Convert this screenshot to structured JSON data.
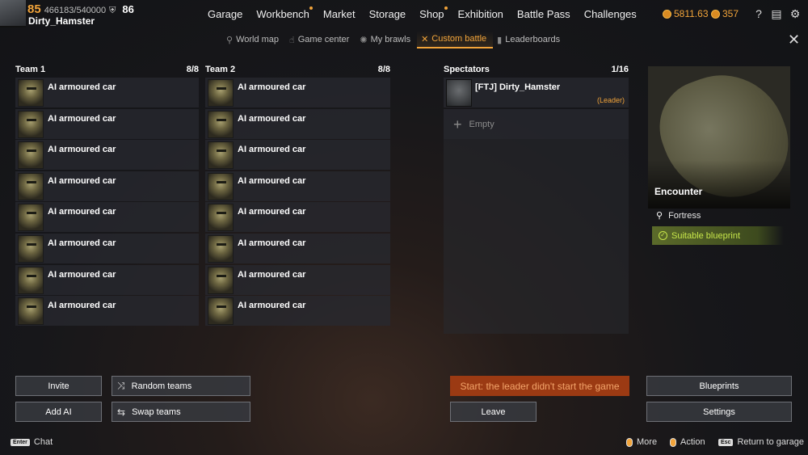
{
  "player": {
    "level": "85",
    "experience": "466183/540000",
    "power_score": "86",
    "name": "Dirty_Hamster"
  },
  "nav": {
    "items": [
      {
        "label": "Garage",
        "dot": false
      },
      {
        "label": "Workbench",
        "dot": true
      },
      {
        "label": "Market",
        "dot": false
      },
      {
        "label": "Storage",
        "dot": false
      },
      {
        "label": "Shop",
        "dot": true
      },
      {
        "label": "Exhibition",
        "dot": false
      },
      {
        "label": "Battle Pass",
        "dot": false
      },
      {
        "label": "Challenges",
        "dot": false
      }
    ]
  },
  "currency": {
    "coins": "5811.63",
    "badges": "357"
  },
  "subnav": {
    "items": [
      {
        "label": "World map",
        "icon": "pin-icon",
        "active": false
      },
      {
        "label": "Game center",
        "icon": "hand-icon",
        "active": false
      },
      {
        "label": "My brawls",
        "icon": "brawl-icon",
        "active": false
      },
      {
        "label": "Custom battle",
        "icon": "custom-battle-icon",
        "active": true
      },
      {
        "label": "Leaderboards",
        "icon": "bars-icon",
        "active": false
      }
    ]
  },
  "team1": {
    "title": "Team 1",
    "count": "8/8",
    "slots": [
      "AI armoured car",
      "AI armoured car",
      "AI armoured car",
      "AI armoured car",
      "AI armoured car",
      "AI armoured car",
      "AI armoured car",
      "AI armoured car"
    ]
  },
  "team2": {
    "title": "Team 2",
    "count": "8/8",
    "slots": [
      "AI armoured car",
      "AI armoured car",
      "AI armoured car",
      "AI armoured car",
      "AI armoured car",
      "AI armoured car",
      "AI armoured car",
      "AI armoured car"
    ]
  },
  "spectators": {
    "title": "Spectators",
    "count": "1/16",
    "leader_name": "[FTJ] Dirty_Hamster",
    "leader_tag": "(Leader)",
    "empty_label": "Empty"
  },
  "map": {
    "mode": "Encounter",
    "location": "Fortress",
    "blueprint_status": "Suitable blueprint"
  },
  "buttons": {
    "invite": "Invite",
    "add_ai": "Add AI",
    "random_teams": "Random teams",
    "swap_teams": "Swap teams",
    "start": "Start: the leader didn't start the game",
    "leave": "Leave",
    "blueprints": "Blueprints",
    "settings": "Settings"
  },
  "footer": {
    "enter_key": "Enter",
    "chat": "Chat",
    "more": "More",
    "action": "Action",
    "esc_key": "Esc",
    "return": "Return to garage"
  },
  "colors": {
    "accent": "#f2a43a",
    "start_button": "#9b3a13",
    "blueprint_ok": "#c7e64a"
  }
}
